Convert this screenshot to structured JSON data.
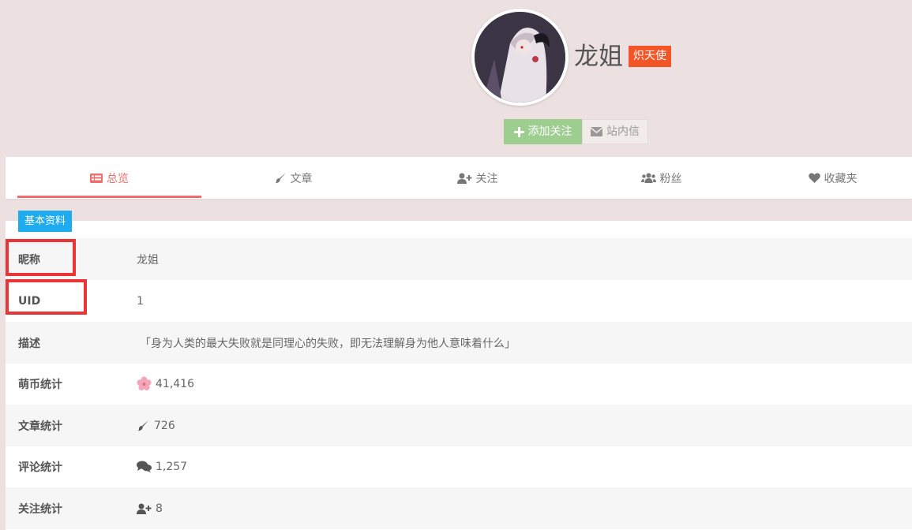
{
  "profile": {
    "username": "龙姐",
    "rank_badge": "炽天使",
    "follow_label": "添加关注",
    "pm_label": "站内信"
  },
  "tabs": [
    {
      "label": "总览",
      "icon": "list-icon",
      "active": true
    },
    {
      "label": "文章",
      "icon": "brush-icon",
      "active": false
    },
    {
      "label": "关注",
      "icon": "user-plus-icon",
      "active": false
    },
    {
      "label": "粉丝",
      "icon": "users-icon",
      "active": false
    },
    {
      "label": "收藏夹",
      "icon": "heart-icon",
      "active": false
    }
  ],
  "section": {
    "title": "基本资料"
  },
  "info_rows": [
    {
      "label": "昵称",
      "value": "龙姐"
    },
    {
      "label": "UID",
      "value": "1"
    },
    {
      "label": "描述",
      "value": "「身为人类的最大失败就是同理心的失败，即无法理解身为他人意味着什么」"
    },
    {
      "label": "萌币统计",
      "value": "41,416",
      "icon": "sakura-icon"
    },
    {
      "label": "文章统计",
      "value": "726",
      "icon": "brush-icon"
    },
    {
      "label": "评论统计",
      "value": "1,257",
      "icon": "comments-icon"
    },
    {
      "label": "关注统计",
      "value": "8",
      "icon": "user-plus-icon"
    }
  ],
  "colors": {
    "background": "#ece1e0",
    "accent": "#f06d6d",
    "badge": "#f35527",
    "follow": "#9dcd8f",
    "section_tag": "#1eabf0",
    "highlight_box": "#e93535"
  }
}
